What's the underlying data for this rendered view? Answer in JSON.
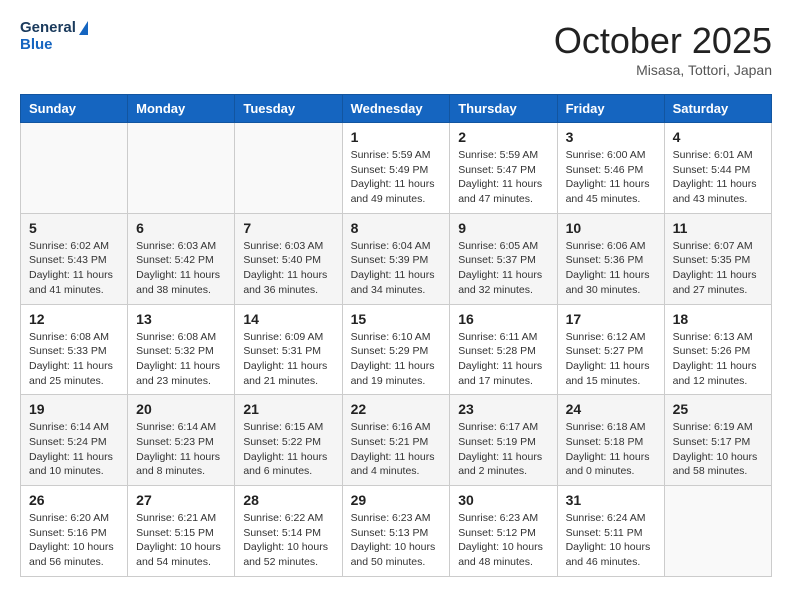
{
  "header": {
    "logo_line1": "General",
    "logo_line2": "Blue",
    "month": "October 2025",
    "location": "Misasa, Tottori, Japan"
  },
  "weekdays": [
    "Sunday",
    "Monday",
    "Tuesday",
    "Wednesday",
    "Thursday",
    "Friday",
    "Saturday"
  ],
  "weeks": [
    [
      {
        "day": "",
        "info": ""
      },
      {
        "day": "",
        "info": ""
      },
      {
        "day": "",
        "info": ""
      },
      {
        "day": "1",
        "info": "Sunrise: 5:59 AM\nSunset: 5:49 PM\nDaylight: 11 hours\nand 49 minutes."
      },
      {
        "day": "2",
        "info": "Sunrise: 5:59 AM\nSunset: 5:47 PM\nDaylight: 11 hours\nand 47 minutes."
      },
      {
        "day": "3",
        "info": "Sunrise: 6:00 AM\nSunset: 5:46 PM\nDaylight: 11 hours\nand 45 minutes."
      },
      {
        "day": "4",
        "info": "Sunrise: 6:01 AM\nSunset: 5:44 PM\nDaylight: 11 hours\nand 43 minutes."
      }
    ],
    [
      {
        "day": "5",
        "info": "Sunrise: 6:02 AM\nSunset: 5:43 PM\nDaylight: 11 hours\nand 41 minutes."
      },
      {
        "day": "6",
        "info": "Sunrise: 6:03 AM\nSunset: 5:42 PM\nDaylight: 11 hours\nand 38 minutes."
      },
      {
        "day": "7",
        "info": "Sunrise: 6:03 AM\nSunset: 5:40 PM\nDaylight: 11 hours\nand 36 minutes."
      },
      {
        "day": "8",
        "info": "Sunrise: 6:04 AM\nSunset: 5:39 PM\nDaylight: 11 hours\nand 34 minutes."
      },
      {
        "day": "9",
        "info": "Sunrise: 6:05 AM\nSunset: 5:37 PM\nDaylight: 11 hours\nand 32 minutes."
      },
      {
        "day": "10",
        "info": "Sunrise: 6:06 AM\nSunset: 5:36 PM\nDaylight: 11 hours\nand 30 minutes."
      },
      {
        "day": "11",
        "info": "Sunrise: 6:07 AM\nSunset: 5:35 PM\nDaylight: 11 hours\nand 27 minutes."
      }
    ],
    [
      {
        "day": "12",
        "info": "Sunrise: 6:08 AM\nSunset: 5:33 PM\nDaylight: 11 hours\nand 25 minutes."
      },
      {
        "day": "13",
        "info": "Sunrise: 6:08 AM\nSunset: 5:32 PM\nDaylight: 11 hours\nand 23 minutes."
      },
      {
        "day": "14",
        "info": "Sunrise: 6:09 AM\nSunset: 5:31 PM\nDaylight: 11 hours\nand 21 minutes."
      },
      {
        "day": "15",
        "info": "Sunrise: 6:10 AM\nSunset: 5:29 PM\nDaylight: 11 hours\nand 19 minutes."
      },
      {
        "day": "16",
        "info": "Sunrise: 6:11 AM\nSunset: 5:28 PM\nDaylight: 11 hours\nand 17 minutes."
      },
      {
        "day": "17",
        "info": "Sunrise: 6:12 AM\nSunset: 5:27 PM\nDaylight: 11 hours\nand 15 minutes."
      },
      {
        "day": "18",
        "info": "Sunrise: 6:13 AM\nSunset: 5:26 PM\nDaylight: 11 hours\nand 12 minutes."
      }
    ],
    [
      {
        "day": "19",
        "info": "Sunrise: 6:14 AM\nSunset: 5:24 PM\nDaylight: 11 hours\nand 10 minutes."
      },
      {
        "day": "20",
        "info": "Sunrise: 6:14 AM\nSunset: 5:23 PM\nDaylight: 11 hours\nand 8 minutes."
      },
      {
        "day": "21",
        "info": "Sunrise: 6:15 AM\nSunset: 5:22 PM\nDaylight: 11 hours\nand 6 minutes."
      },
      {
        "day": "22",
        "info": "Sunrise: 6:16 AM\nSunset: 5:21 PM\nDaylight: 11 hours\nand 4 minutes."
      },
      {
        "day": "23",
        "info": "Sunrise: 6:17 AM\nSunset: 5:19 PM\nDaylight: 11 hours\nand 2 minutes."
      },
      {
        "day": "24",
        "info": "Sunrise: 6:18 AM\nSunset: 5:18 PM\nDaylight: 11 hours\nand 0 minutes."
      },
      {
        "day": "25",
        "info": "Sunrise: 6:19 AM\nSunset: 5:17 PM\nDaylight: 10 hours\nand 58 minutes."
      }
    ],
    [
      {
        "day": "26",
        "info": "Sunrise: 6:20 AM\nSunset: 5:16 PM\nDaylight: 10 hours\nand 56 minutes."
      },
      {
        "day": "27",
        "info": "Sunrise: 6:21 AM\nSunset: 5:15 PM\nDaylight: 10 hours\nand 54 minutes."
      },
      {
        "day": "28",
        "info": "Sunrise: 6:22 AM\nSunset: 5:14 PM\nDaylight: 10 hours\nand 52 minutes."
      },
      {
        "day": "29",
        "info": "Sunrise: 6:23 AM\nSunset: 5:13 PM\nDaylight: 10 hours\nand 50 minutes."
      },
      {
        "day": "30",
        "info": "Sunrise: 6:23 AM\nSunset: 5:12 PM\nDaylight: 10 hours\nand 48 minutes."
      },
      {
        "day": "31",
        "info": "Sunrise: 6:24 AM\nSunset: 5:11 PM\nDaylight: 10 hours\nand 46 minutes."
      },
      {
        "day": "",
        "info": ""
      }
    ]
  ]
}
